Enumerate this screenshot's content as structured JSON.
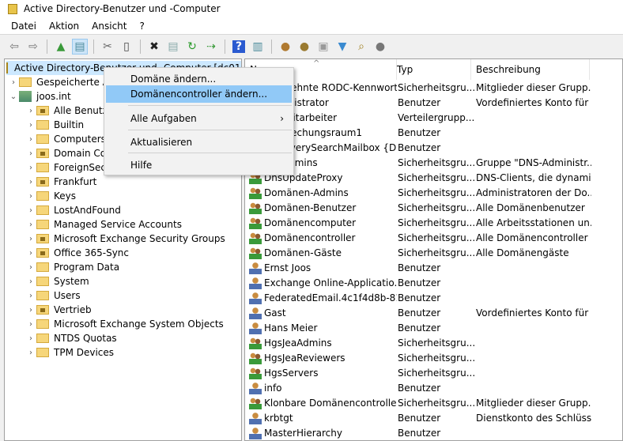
{
  "window": {
    "title": "Active Directory-Benutzer und -Computer"
  },
  "menubar": [
    "Datei",
    "Aktion",
    "Ansicht",
    "?"
  ],
  "toolbar": [
    "back-arrow",
    "forward-arrow",
    "up-folder",
    "show-hide-console-tree",
    "cut",
    "paste",
    "delete",
    "properties",
    "refresh",
    "export-list",
    "help",
    "show-action-pane",
    "new-user",
    "new-group",
    "new-ou",
    "filter",
    "find",
    "add-to-group"
  ],
  "tree": {
    "root": "Active Directory-Benutzer und -Computer [dc01.joos.int]",
    "saved": "Gespeicherte Abfragen",
    "domain": "joos.int",
    "children": [
      {
        "label": "Alle Benutzer",
        "ou": true
      },
      {
        "label": "Builtin",
        "ou": false
      },
      {
        "label": "Computers",
        "ou": false
      },
      {
        "label": "Domain Controllers",
        "ou": true
      },
      {
        "label": "ForeignSecurityPrincipals",
        "ou": false
      },
      {
        "label": "Frankfurt",
        "ou": true
      },
      {
        "label": "Keys",
        "ou": false
      },
      {
        "label": "LostAndFound",
        "ou": false
      },
      {
        "label": "Managed Service Accounts",
        "ou": false
      },
      {
        "label": "Microsoft Exchange Security Groups",
        "ou": true
      },
      {
        "label": "Office 365-Sync",
        "ou": true
      },
      {
        "label": "Program Data",
        "ou": false
      },
      {
        "label": "System",
        "ou": false
      },
      {
        "label": "Users",
        "ou": false
      },
      {
        "label": "Vertrieb",
        "ou": true
      },
      {
        "label": "Microsoft Exchange System Objects",
        "ou": false
      },
      {
        "label": "NTDS Quotas",
        "ou": false
      },
      {
        "label": "TPM Devices",
        "ou": false
      }
    ]
  },
  "list": {
    "headers": [
      "Name",
      "Typ",
      "Beschreibung"
    ],
    "rows": [
      [
        "Abgelehnte RODC-Kennwort...",
        "Sicherheitsgru...",
        "Mitglieder dieser Grupp..."
      ],
      [
        "Administrator",
        "Benutzer",
        "Vordefiniertes Konto für ..."
      ],
      [
        "Alle Mitarbeiter",
        "Verteilergrupp...",
        ""
      ],
      [
        "Besprechungsraum1",
        "Benutzer",
        ""
      ],
      [
        "DiscoverySearchMailbox {D9...",
        "Benutzer",
        ""
      ],
      [
        "DnsAdmins",
        "Sicherheitsgru...",
        "Gruppe \"DNS-Administr..."
      ],
      [
        "DnsUpdateProxy",
        "Sicherheitsgru...",
        "DNS-Clients, die dynami..."
      ],
      [
        "Domänen-Admins",
        "Sicherheitsgru...",
        "Administratoren der Do..."
      ],
      [
        "Domänen-Benutzer",
        "Sicherheitsgru...",
        "Alle Domänenbenutzer"
      ],
      [
        "Domänencomputer",
        "Sicherheitsgru...",
        "Alle Arbeitsstationen un..."
      ],
      [
        "Domänencontroller",
        "Sicherheitsgru...",
        "Alle Domänencontroller ..."
      ],
      [
        "Domänen-Gäste",
        "Sicherheitsgru...",
        "Alle Domänengäste"
      ],
      [
        "Ernst Joos",
        "Benutzer",
        ""
      ],
      [
        "Exchange Online-Applicatio...",
        "Benutzer",
        ""
      ],
      [
        "FederatedEmail.4c1f4d8b-81...",
        "Benutzer",
        ""
      ],
      [
        "Gast",
        "Benutzer",
        "Vordefiniertes Konto für ..."
      ],
      [
        "Hans Meier",
        "Benutzer",
        ""
      ],
      [
        "HgsJeaAdmins",
        "Sicherheitsgru...",
        ""
      ],
      [
        "HgsJeaReviewers",
        "Sicherheitsgru...",
        ""
      ],
      [
        "HgsServers",
        "Sicherheitsgru...",
        ""
      ],
      [
        "info",
        "Benutzer",
        ""
      ],
      [
        "Klonbare Domänencontroller",
        "Sicherheitsgru...",
        "Mitglieder dieser Grupp..."
      ],
      [
        "krbtgt",
        "Benutzer",
        "Dienstkonto des Schlüss..."
      ],
      [
        "MasterHierarchy",
        "Benutzer",
        ""
      ]
    ]
  },
  "context_menu": {
    "items": [
      {
        "label": "Domäne ändern...",
        "highlighted": false
      },
      {
        "label": "Domänencontroller ändern...",
        "highlighted": true
      },
      {
        "label": "Alle Aufgaben",
        "submenu": true
      },
      {
        "label": "Aktualisieren"
      },
      {
        "label": "Hilfe"
      }
    ]
  },
  "colors": {
    "highlight": "#91c9f7",
    "selection": "#cce8ff"
  }
}
